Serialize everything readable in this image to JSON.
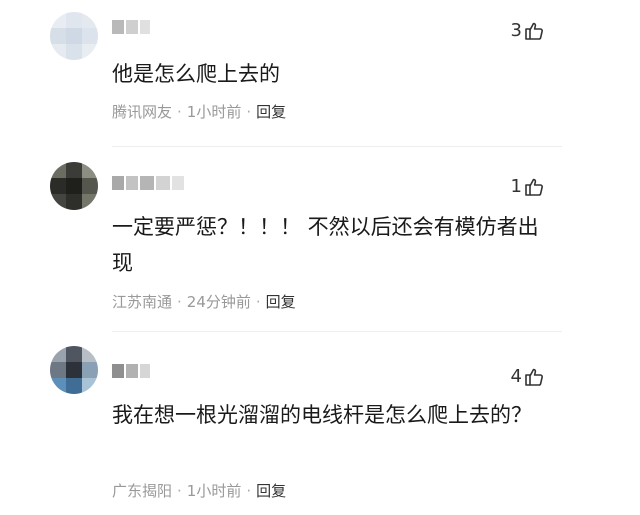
{
  "comments": [
    {
      "likes": "3",
      "text": "他是怎么爬上去的",
      "location": "腾讯网友",
      "time": "1小时前",
      "reply_label": "回复"
    },
    {
      "likes": "1",
      "text": "一定要严惩？！！！ 不然以后还会有模仿者出现",
      "location": "江苏南通",
      "time": "24分钟前",
      "reply_label": "回复"
    },
    {
      "likes": "4",
      "text": "我在想一根光溜溜的电线杆是怎么爬上去的？",
      "location": "广东揭阳",
      "time": "1小时前",
      "reply_label": "回复"
    }
  ],
  "icons": {
    "like": "thumbs-up-icon"
  },
  "colors": {
    "meta": "#999999",
    "reply": "#333333",
    "text": "#1a1a1a"
  }
}
